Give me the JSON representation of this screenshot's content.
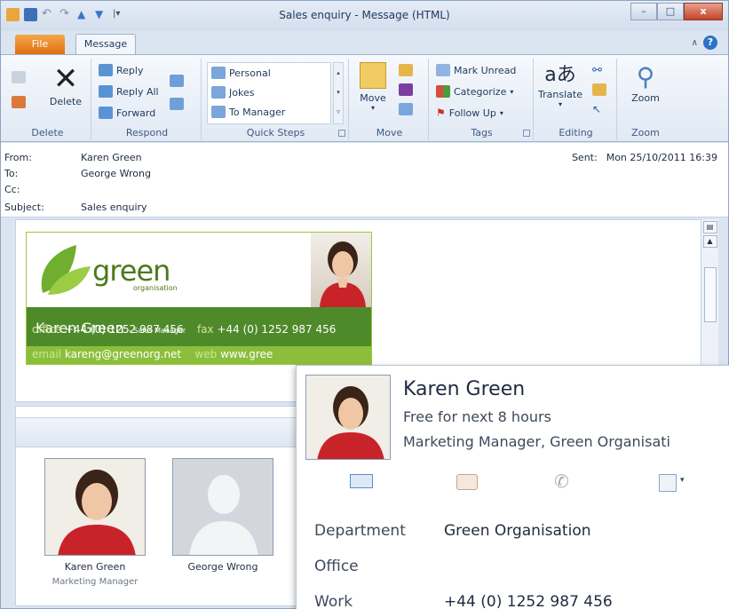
{
  "window": {
    "title": "Sales enquiry - Message (HTML)",
    "controls": {
      "minimize": "–",
      "maximize": "□",
      "close": "x"
    }
  },
  "tabs": {
    "file": "File",
    "message": "Message"
  },
  "help": {
    "collapse": "∧",
    "question": "?"
  },
  "ribbon": {
    "delete_group": {
      "label": "Delete",
      "delete": "Delete"
    },
    "respond_group": {
      "label": "Respond",
      "reply": "Reply",
      "reply_all": "Reply All",
      "forward": "Forward"
    },
    "quicksteps_group": {
      "label": "Quick Steps",
      "items": [
        "Personal",
        "Jokes",
        "To Manager"
      ]
    },
    "move_group": {
      "label": "Move",
      "move": "Move"
    },
    "tags_group": {
      "label": "Tags",
      "mark_unread": "Mark Unread",
      "categorize": "Categorize",
      "follow_up": "Follow Up"
    },
    "editing_group": {
      "label": "Editing",
      "translate": "Translate"
    },
    "zoom_group": {
      "label": "Zoom",
      "zoom": "Zoom"
    }
  },
  "header": {
    "from_label": "From:",
    "from": "Karen Green",
    "to_label": "To:",
    "to": "George Wrong",
    "cc_label": "Cc:",
    "subject_label": "Subject:",
    "subject": "Sales enquiry",
    "sent_label": "Sent:",
    "sent": "Mon 25/10/2011 16:39"
  },
  "signature": {
    "wordmark": "green",
    "sub": "organisation",
    "name": "Karen Green",
    "role": "- Sales Manager",
    "office_label": "office",
    "office": "+44 (0) 1252 987 456",
    "fax_label": "fax",
    "fax": "+44 (0) 1252 987 456",
    "email_label": "email",
    "email": "kareng@greenorg.net",
    "web_label": "web",
    "web": "www.gree"
  },
  "people": [
    {
      "name": "Karen Green",
      "title": "Marketing Manager"
    },
    {
      "name": "George Wrong",
      "title": ""
    }
  ],
  "contact_card": {
    "name": "Karen Green",
    "availability": "Free for next 8 hours",
    "role": "Marketing Manager, Green Organisati",
    "fields": [
      {
        "label": "Department",
        "value": "Green Organisation"
      },
      {
        "label": "Office",
        "value": ""
      },
      {
        "label": "Work",
        "value": "+44 (0) 1252 987 456"
      }
    ]
  },
  "colors": {
    "file_tab": "#e06f12",
    "sig_green": "#4f8a2a",
    "sig_lime": "#8bbf3b",
    "brand_green": "#4b7a1c"
  }
}
